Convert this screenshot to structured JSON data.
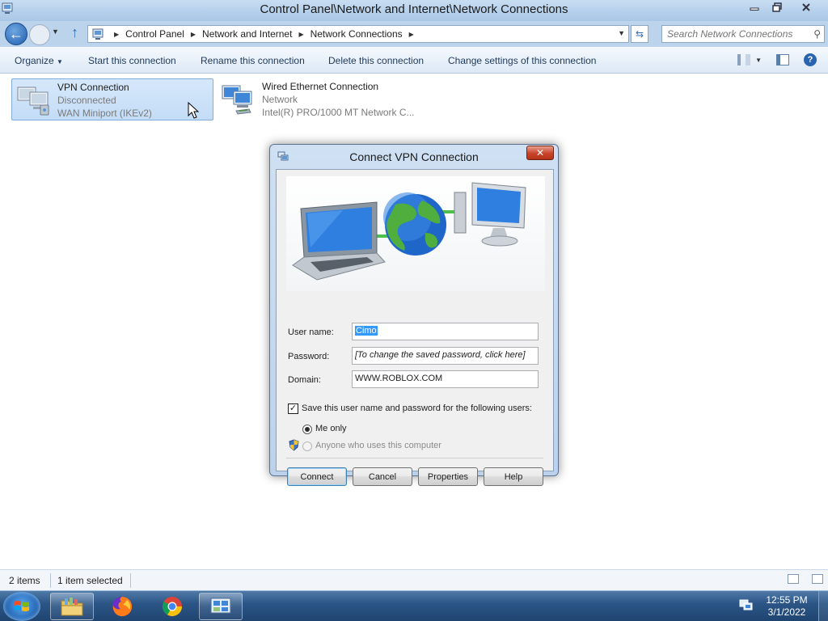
{
  "window": {
    "title": "Control Panel\\Network and Internet\\Network Connections",
    "minimize_icon": "minimize-icon",
    "maximize_icon": "restore-icon",
    "close_icon": "close-icon"
  },
  "address": {
    "crumbs": [
      "Control Panel",
      "Network and Internet",
      "Network Connections"
    ],
    "search_placeholder": "Search Network Connections"
  },
  "toolbar": {
    "organize": "Organize",
    "start_connection": "Start this connection",
    "rename": "Rename this connection",
    "delete": "Delete this connection",
    "change_settings": "Change settings of this connection"
  },
  "items": [
    {
      "name": "VPN Connection",
      "status": "Disconnected",
      "device": "WAN Miniport (IKEv2)",
      "selected": true
    },
    {
      "name": "Wired Ethernet Connection",
      "status": "Network",
      "device": "Intel(R) PRO/1000 MT Network C...",
      "selected": false
    }
  ],
  "dialog": {
    "title": "Connect VPN Connection",
    "username_label": "User name:",
    "username_value": "Cimo",
    "password_label": "Password:",
    "password_value": "[To change the saved password, click here]",
    "domain_label": "Domain:",
    "domain_value": "WWW.ROBLOX.COM",
    "save_checkbox_label": "Save this user name and password for the following users:",
    "save_checked": true,
    "radio_me_only": "Me only",
    "radio_anyone": "Anyone who uses this computer",
    "btn_connect": "Connect",
    "btn_cancel": "Cancel",
    "btn_properties": "Properties",
    "btn_help": "Help"
  },
  "status": {
    "items_count": "2 items",
    "selected": "1 item selected"
  },
  "taskbar": {
    "time": "12:55 PM",
    "date": "3/1/2022",
    "apps": [
      "file-explorer-icon",
      "firefox-icon",
      "chrome-icon",
      "network-connections-icon"
    ]
  },
  "colors": {
    "accent": "#2a64b0",
    "selection": "#c3dcf6",
    "close_red": "#c8432a"
  }
}
